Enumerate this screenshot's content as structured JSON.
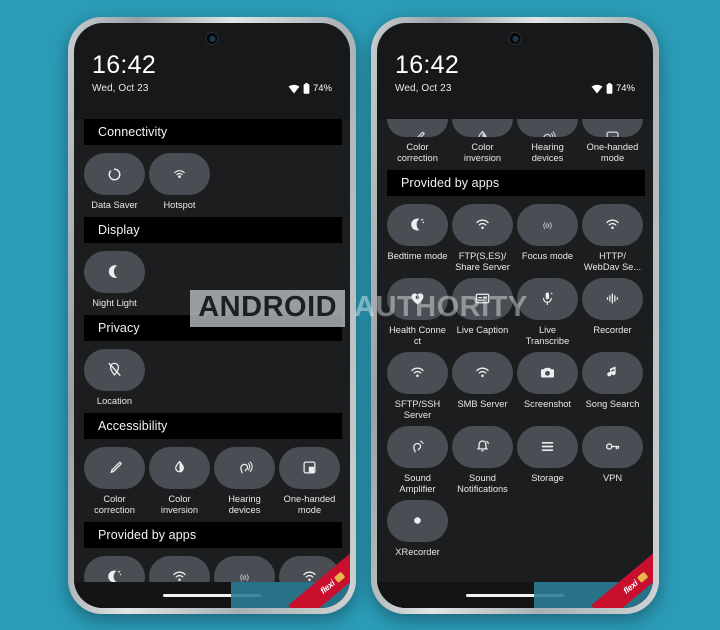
{
  "background_color": "#2b9cb8",
  "watermark": {
    "word1": "ANDROID",
    "word2": "AUTHORITY"
  },
  "status_bar": {
    "time": "16:42",
    "date": "Wed, Oct 23",
    "battery": "74%",
    "wifi_icon": "wifi-icon",
    "battery_icon": "battery-icon"
  },
  "ribbon": {
    "label": "flexi"
  },
  "phones": [
    {
      "id": "phone-left",
      "sections": [
        {
          "title": "Connectivity",
          "clipped": false,
          "tiles": [
            {
              "label": "Data Saver",
              "icon": "data-saver-icon"
            },
            {
              "label": "Hotspot",
              "icon": "hotspot-icon"
            }
          ]
        },
        {
          "title": "Display",
          "clipped": false,
          "tiles": [
            {
              "label": "Night Light",
              "icon": "moon-icon"
            }
          ]
        },
        {
          "title": "Privacy",
          "clipped": false,
          "tiles": [
            {
              "label": "Location",
              "icon": "location-off-icon"
            }
          ]
        },
        {
          "title": "Accessibility",
          "clipped": false,
          "tiles": [
            {
              "label": "Color correction",
              "icon": "eyedropper-icon"
            },
            {
              "label": "Color inversion",
              "icon": "contrast-droplet-icon"
            },
            {
              "label": "Hearing devices",
              "icon": "ear-icon"
            },
            {
              "label": "One-handed mode",
              "icon": "one-handed-icon"
            }
          ]
        },
        {
          "title": "Provided by apps",
          "clipped": false,
          "tiles": [
            {
              "label": "",
              "icon": "bedtime-moon-icon"
            },
            {
              "label": "",
              "icon": "wifi-icon"
            },
            {
              "label": "",
              "icon": "focus-icon"
            },
            {
              "label": "",
              "icon": "wifi-icon"
            }
          ]
        }
      ]
    },
    {
      "id": "phone-right",
      "sections": [
        {
          "title": null,
          "clipped": true,
          "tiles": [
            {
              "label": "Color correction",
              "icon": "eyedropper-icon"
            },
            {
              "label": "Color inversion",
              "icon": "contrast-droplet-icon"
            },
            {
              "label": "Hearing devices",
              "icon": "ear-icon"
            },
            {
              "label": "One-handed mode",
              "icon": "one-handed-icon"
            }
          ]
        },
        {
          "title": "Provided by apps",
          "clipped": false,
          "tiles": [
            {
              "label": "Bedtime mode",
              "icon": "bedtime-moon-icon"
            },
            {
              "label": "FTP(S,ES)/ Share Server",
              "icon": "wifi-icon"
            },
            {
              "label": "Focus mode",
              "icon": "focus-icon"
            },
            {
              "label": "HTTP/ WebDav Se...",
              "icon": "wifi-icon"
            },
            {
              "label": "Health Conne ct",
              "icon": "health-heart-icon"
            },
            {
              "label": "Live Caption",
              "icon": "caption-icon"
            },
            {
              "label": "Live Transcribe",
              "icon": "mic-transcribe-icon"
            },
            {
              "label": "Recorder",
              "icon": "waveform-icon"
            },
            {
              "label": "SFTP/SSH Server",
              "icon": "wifi-icon"
            },
            {
              "label": "SMB Server",
              "icon": "wifi-icon"
            },
            {
              "label": "Screenshot",
              "icon": "camera-icon"
            },
            {
              "label": "Song Search",
              "icon": "music-note-icon"
            },
            {
              "label": "Sound Amplifier",
              "icon": "sound-amplifier-icon"
            },
            {
              "label": "Sound Notifications",
              "icon": "bell-sound-icon"
            },
            {
              "label": "Storage",
              "icon": "storage-list-icon"
            },
            {
              "label": "VPN",
              "icon": "vpn-key-icon"
            },
            {
              "label": "XRecorder",
              "icon": "record-dot-icon"
            }
          ]
        }
      ]
    }
  ]
}
